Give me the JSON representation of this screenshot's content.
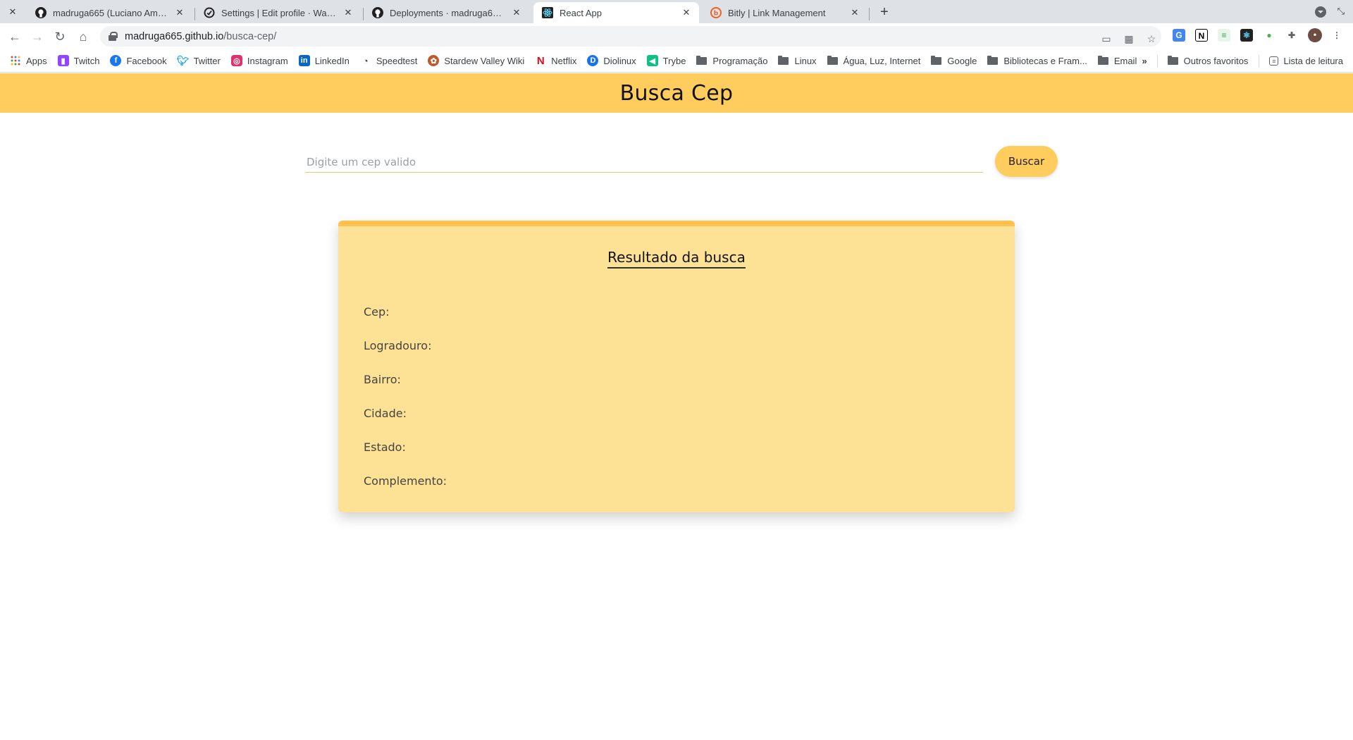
{
  "browser": {
    "tabs": [
      {
        "title": "madruga665 (Luciano Amâncio)",
        "icon": "github-icon",
        "active": false
      },
      {
        "title": "Settings | Edit profile · WakaTime",
        "icon": "wakatime-icon",
        "active": false
      },
      {
        "title": "Deployments · madruga665/busca-cep",
        "icon": "github-icon",
        "active": false
      },
      {
        "title": "React App",
        "icon": "react-icon",
        "active": true
      },
      {
        "title": "Bitly | Link Management",
        "icon": "bitly-icon",
        "active": false
      }
    ],
    "url": {
      "host": "madruga665.github.io",
      "path": "/busca-cep/"
    },
    "bookmarks": [
      {
        "label": "Apps",
        "icon": "apps-grid-icon"
      },
      {
        "label": "Twitch",
        "icon": "twitch-icon"
      },
      {
        "label": "Facebook",
        "icon": "facebook-icon"
      },
      {
        "label": "Twitter",
        "icon": "twitter-icon"
      },
      {
        "label": "Instagram",
        "icon": "instagram-icon"
      },
      {
        "label": "LinkedIn",
        "icon": "linkedin-icon"
      },
      {
        "label": "Speedtest",
        "icon": "speedtest-icon"
      },
      {
        "label": "Stardew Valley Wiki",
        "icon": "stardew-icon"
      },
      {
        "label": "Netflix",
        "icon": "netflix-icon"
      },
      {
        "label": "Diolinux",
        "icon": "diolinux-icon"
      },
      {
        "label": "Trybe",
        "icon": "trybe-icon"
      },
      {
        "label": "Programação",
        "icon": "folder-icon"
      },
      {
        "label": "Linux",
        "icon": "folder-icon"
      },
      {
        "label": "Água, Luz, Internet",
        "icon": "folder-icon"
      },
      {
        "label": "Google",
        "icon": "folder-icon"
      },
      {
        "label": "Bibliotecas e Fram...",
        "icon": "folder-icon"
      },
      {
        "label": "Email",
        "icon": "folder-icon"
      }
    ],
    "bookmarks_right": {
      "more": "»",
      "other": "Outros favoritos",
      "reading_list": "Lista de leitura"
    }
  },
  "app": {
    "title": "Busca Cep",
    "search": {
      "placeholder": "Digite um cep valido",
      "value": "",
      "button": "Buscar"
    },
    "result": {
      "heading": "Resultado da busca",
      "fields": [
        "Cep:",
        "Logradouro:",
        "Bairro:",
        "Cidade:",
        "Estado:",
        "Complemento:"
      ]
    }
  },
  "colors": {
    "accent": "#ffcd5e",
    "card": "#fde194",
    "card_border": "#ffc04d"
  }
}
